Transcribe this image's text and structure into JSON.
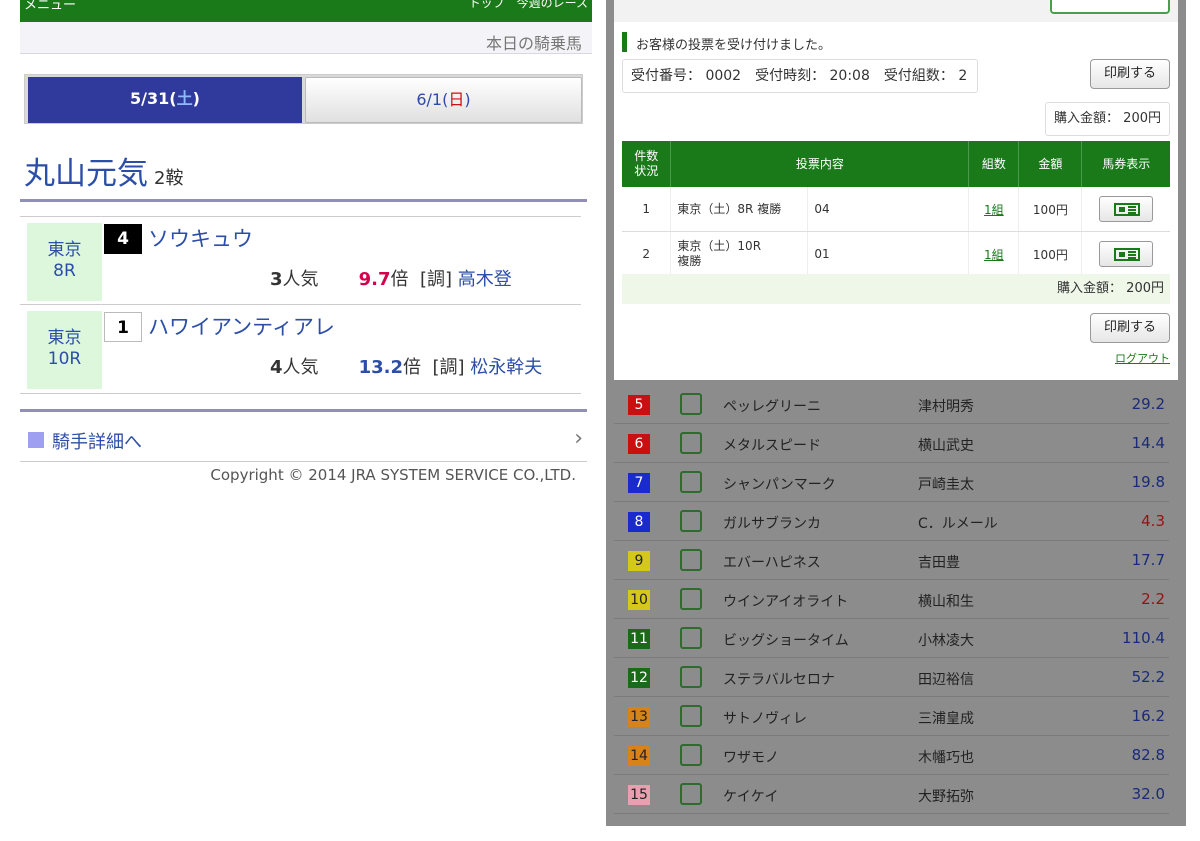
{
  "left": {
    "menu_label": "メニュー",
    "top_link": "トップ　今週のレース",
    "subheader": "本日の騎乗馬",
    "date_tabs": [
      {
        "date": "5/31(",
        "day": "土",
        "close": ")"
      },
      {
        "date": "6/1(",
        "day": "日",
        "close": ")"
      }
    ],
    "jockey_name": "丸山元気",
    "rides": "2鞍",
    "races": [
      {
        "venue": "東京",
        "race": "8R",
        "number": "4",
        "horse": "ソウキュウ",
        "popularity": "3",
        "popularity_suffix": "人気",
        "odds": "9.7",
        "odds_suffix": "倍",
        "trainer_tag": "[調]",
        "trainer": "高木登"
      },
      {
        "venue": "東京",
        "race": "10R",
        "number": "1",
        "horse": "ハワイアンティアレ",
        "popularity": "4",
        "popularity_suffix": "人気",
        "odds": "13.2",
        "odds_suffix": "倍",
        "trainer_tag": "[調]",
        "trainer": "松永幹夫"
      }
    ],
    "detail_link": "騎手詳細へ",
    "copyright": "Copyright © 2014 JRA SYSTEM SERVICE CO.,LTD."
  },
  "modal": {
    "message": "お客様の投票を受け付けました。",
    "receipt": "受付番号： 0002　受付時刻： 20:08　受付組数： 2",
    "print_label": "印刷する",
    "purchase_amount": "購入金額： 200円",
    "table": {
      "headers": [
        "件数\n状況",
        "投票内容",
        "組数",
        "金額",
        "馬券表示"
      ],
      "rows": [
        {
          "no": "1",
          "race": "東京（土）8R 複勝",
          "content": "04",
          "sets": "1組",
          "amount": "100円"
        },
        {
          "no": "2",
          "race": "東京（土）10R\n複勝",
          "content": "01",
          "sets": "1組",
          "amount": "100円"
        }
      ]
    },
    "total": "購入金額： 200円",
    "logout": "ログアウト"
  },
  "horse_list": [
    {
      "num": "5",
      "color": "#c81010",
      "fg": "#ffffff",
      "horse": "ペッレグリーニ",
      "jockey": "津村明秀",
      "odds": "29.2",
      "fav": false
    },
    {
      "num": "6",
      "color": "#c81010",
      "fg": "#ffffff",
      "horse": "メタルスピード",
      "jockey": "横山武史",
      "odds": "14.4",
      "fav": false
    },
    {
      "num": "7",
      "color": "#1a2acc",
      "fg": "#ffffff",
      "horse": "シャンパンマーク",
      "jockey": "戸崎圭太",
      "odds": "19.8",
      "fav": false
    },
    {
      "num": "8",
      "color": "#1a2acc",
      "fg": "#ffffff",
      "horse": "ガルサブランカ",
      "jockey": "C．ルメール",
      "odds": "4.3",
      "fav": true
    },
    {
      "num": "9",
      "color": "#d6c81a",
      "fg": "#222222",
      "horse": "エバーハピネス",
      "jockey": "吉田豊",
      "odds": "17.7",
      "fav": false
    },
    {
      "num": "10",
      "color": "#d6c81a",
      "fg": "#222222",
      "horse": "ウインアイオライト",
      "jockey": "横山和生",
      "odds": "2.2",
      "fav": true
    },
    {
      "num": "11",
      "color": "#1a6a1a",
      "fg": "#ffffff",
      "horse": "ビッグショータイム",
      "jockey": "小林凌大",
      "odds": "110.4",
      "fav": false
    },
    {
      "num": "12",
      "color": "#1a6a1a",
      "fg": "#ffffff",
      "horse": "ステラバルセロナ",
      "jockey": "田辺裕信",
      "odds": "52.2",
      "fav": false
    },
    {
      "num": "13",
      "color": "#d8821a",
      "fg": "#222222",
      "horse": "サトノヴィレ",
      "jockey": "三浦皇成",
      "odds": "16.2",
      "fav": false
    },
    {
      "num": "14",
      "color": "#d8821a",
      "fg": "#222222",
      "horse": "ワザモノ",
      "jockey": "木幡巧也",
      "odds": "82.8",
      "fav": false
    },
    {
      "num": "15",
      "color": "#e8a0b0",
      "fg": "#222222",
      "horse": "ケイケイ",
      "jockey": "大野拓弥",
      "odds": "32.0",
      "fav": false
    }
  ]
}
